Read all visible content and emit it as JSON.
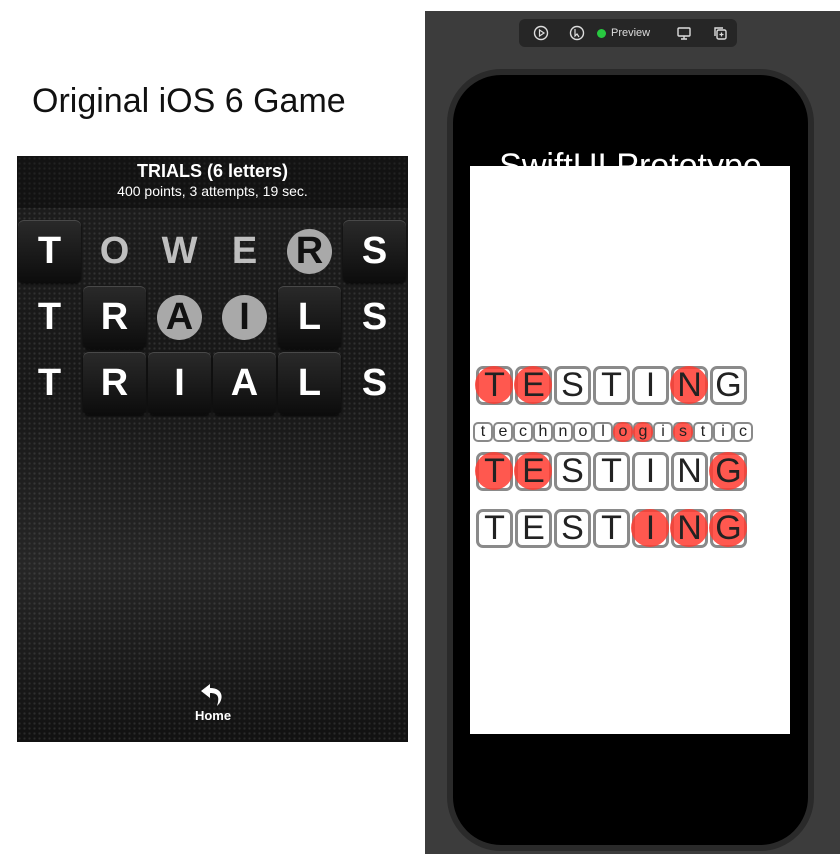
{
  "left": {
    "title": "Original iOS 6 Game",
    "header_title": "TRIALS (6 letters)",
    "header_sub": "400 points, 3 attempts, 19 sec.",
    "rows": [
      [
        {
          "l": "T",
          "s": "dark"
        },
        {
          "l": "O",
          "s": "ghost"
        },
        {
          "l": "W",
          "s": "ghost"
        },
        {
          "l": "E",
          "s": "ghost"
        },
        {
          "l": "R",
          "s": "circle"
        },
        {
          "l": "S",
          "s": "dark"
        }
      ],
      [
        {
          "l": "T",
          "s": "plain"
        },
        {
          "l": "R",
          "s": "dark"
        },
        {
          "l": "A",
          "s": "circle"
        },
        {
          "l": "I",
          "s": "circle"
        },
        {
          "l": "L",
          "s": "dark"
        },
        {
          "l": "S",
          "s": "plain"
        }
      ],
      [
        {
          "l": "T",
          "s": "plain"
        },
        {
          "l": "R",
          "s": "dark"
        },
        {
          "l": "I",
          "s": "dark"
        },
        {
          "l": "A",
          "s": "dark"
        },
        {
          "l": "L",
          "s": "dark"
        },
        {
          "l": "S",
          "s": "plain"
        }
      ]
    ],
    "home_label": "Home"
  },
  "right": {
    "toolbar_preview_label": "Preview",
    "title": "SwiftUI Prototype",
    "rows": [
      {
        "size": "big",
        "letters": [
          "T",
          "E",
          "S",
          "T",
          "I",
          "N",
          "G"
        ],
        "hl": [
          0,
          1,
          5
        ]
      },
      {
        "size": "small",
        "letters": [
          "t",
          "e",
          "c",
          "h",
          "n",
          "o",
          "l",
          "o",
          "g",
          "i",
          "s",
          "t",
          "i",
          "c"
        ],
        "hl": [
          7,
          8,
          10
        ]
      },
      {
        "size": "big",
        "letters": [
          "T",
          "E",
          "S",
          "T",
          "I",
          "N",
          "G"
        ],
        "hl": [
          0,
          1,
          6
        ]
      },
      {
        "size": "big",
        "letters": [
          "T",
          "E",
          "S",
          "T",
          "I",
          "N",
          "G"
        ],
        "hl": [
          4,
          5,
          6
        ]
      }
    ]
  },
  "colors": {
    "highlight": "#ff3b30",
    "status_green": "#28c840"
  }
}
